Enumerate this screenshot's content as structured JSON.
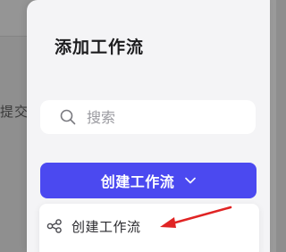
{
  "backdrop": {
    "partial_text": "提交"
  },
  "panel": {
    "title": "添加工作流",
    "search": {
      "placeholder": "搜索",
      "value": "",
      "icon": "search-icon"
    },
    "create_button": {
      "label": "创建工作流",
      "icon": "chevron-down-icon",
      "color": "#4b49f0"
    },
    "dropdown": {
      "items": [
        {
          "label": "创建工作流",
          "icon": "workflow-nodes-icon"
        }
      ]
    }
  },
  "annotation": {
    "arrow_color": "#e02424"
  }
}
